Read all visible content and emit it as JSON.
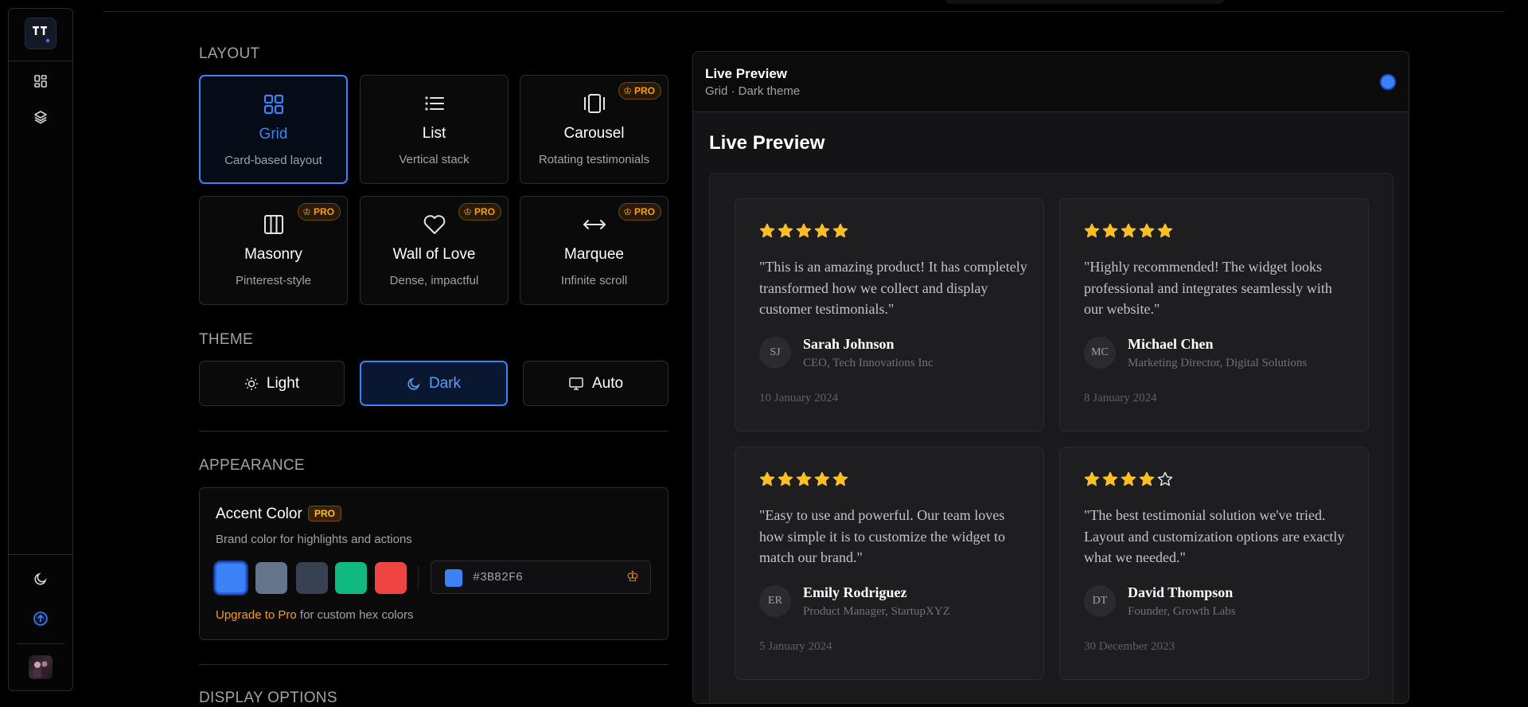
{
  "sidebar": {
    "logo_icon": "app-logo",
    "nav": [
      {
        "icon": "dashboard-icon"
      },
      {
        "icon": "layers-icon"
      }
    ],
    "bottom": [
      {
        "icon": "moon-icon"
      },
      {
        "icon": "upgrade-icon"
      }
    ]
  },
  "layout": {
    "section_title": "LAYOUT",
    "cards": [
      {
        "title": "Grid",
        "subtitle": "Card-based layout",
        "icon": "grid-icon",
        "pro": false,
        "active": true
      },
      {
        "title": "List",
        "subtitle": "Vertical stack",
        "icon": "list-icon",
        "pro": false,
        "active": false
      },
      {
        "title": "Carousel",
        "subtitle": "Rotating testimonials",
        "icon": "carousel-icon",
        "pro": true,
        "active": false
      },
      {
        "title": "Masonry",
        "subtitle": "Pinterest-style",
        "icon": "masonry-icon",
        "pro": true,
        "active": false
      },
      {
        "title": "Wall of Love",
        "subtitle": "Dense, impactful",
        "icon": "heart-icon",
        "pro": true,
        "active": false
      },
      {
        "title": "Marquee",
        "subtitle": "Infinite scroll",
        "icon": "arrows-horizontal-icon",
        "pro": true,
        "active": false
      }
    ],
    "pro_label": "PRO"
  },
  "theme": {
    "section_title": "THEME",
    "options": [
      {
        "label": "Light",
        "icon": "sun-icon",
        "active": false
      },
      {
        "label": "Dark",
        "icon": "moon-icon",
        "active": true
      },
      {
        "label": "Auto",
        "icon": "monitor-icon",
        "active": false
      }
    ]
  },
  "appearance": {
    "section_title": "APPEARANCE",
    "accent_title": "Accent Color",
    "accent_badge": "PRO",
    "accent_desc": "Brand color for highlights and actions",
    "swatches": [
      "#3B82F6",
      "#64748B",
      "#374151",
      "#10B981",
      "#EF4444"
    ],
    "hex_value": "#3B82F6",
    "upgrade_link": "Upgrade to Pro",
    "upgrade_rest": " for custom hex colors"
  },
  "display_options": {
    "section_title": "DISPLAY OPTIONS"
  },
  "preview": {
    "header_title": "Live Preview",
    "header_sub": "Grid · Dark theme",
    "title": "Live Preview",
    "accent": "#3B82F6",
    "testimonials": [
      {
        "rating": 5,
        "quote": "\"This is an amazing product! It has completely transformed how we collect and display customer testimonials.\"",
        "initials": "SJ",
        "name": "Sarah Johnson",
        "role": "CEO, Tech Innovations Inc",
        "date": "10 January 2024"
      },
      {
        "rating": 5,
        "quote": "\"Highly recommended! The widget looks professional and integrates seamlessly with our website.\"",
        "initials": "MC",
        "name": "Michael Chen",
        "role": "Marketing Director, Digital Solutions",
        "date": "8 January 2024"
      },
      {
        "rating": 5,
        "quote": "\"Easy to use and powerful. Our team loves how simple it is to customize the widget to match our brand.\"",
        "initials": "ER",
        "name": "Emily Rodriguez",
        "role": "Product Manager, StartupXYZ",
        "date": "5 January 2024"
      },
      {
        "rating": 4,
        "quote": "\"The best testimonial solution we've tried. Layout and customization options are exactly what we needed.\"",
        "initials": "DT",
        "name": "David Thompson",
        "role": "Founder, Growth Labs",
        "date": "30 December 2023"
      }
    ]
  }
}
